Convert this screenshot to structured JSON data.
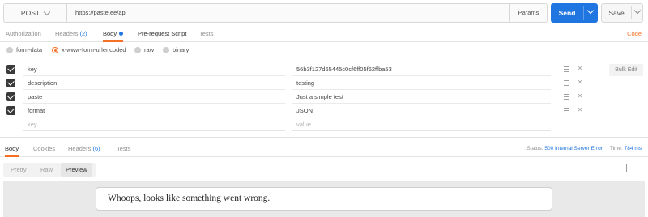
{
  "request": {
    "method": "POST",
    "url": "https://paste.ee/api",
    "params_label": "Params",
    "send_label": "Send",
    "save_label": "Save"
  },
  "request_tabs": {
    "authorization": "Authorization",
    "headers_label": "Headers",
    "headers_count": "(2)",
    "body": "Body",
    "prerequest": "Pre-request Script",
    "tests": "Tests",
    "code": "Code"
  },
  "body_types": {
    "form_data": "form-data",
    "urlencoded": "x-www-form-urlencoded",
    "raw": "raw",
    "binary": "binary",
    "selected": "x-www-form-urlencoded"
  },
  "params": [
    {
      "checked": true,
      "key": "key",
      "value": "56b3f127d65445c0cf6ff05f62ffba53"
    },
    {
      "checked": true,
      "key": "description",
      "value": "testing"
    },
    {
      "checked": true,
      "key": "paste",
      "value": "Just a simple test"
    },
    {
      "checked": true,
      "key": "format",
      "value": "JSON"
    }
  ],
  "new_row": {
    "key_placeholder": "key",
    "value_placeholder": "value"
  },
  "bulk_edit_label": "Bulk Edit",
  "response_tabs": {
    "body": "Body",
    "cookies": "Cookies",
    "headers_label": "Headers",
    "headers_count": "(6)",
    "tests": "Tests"
  },
  "response_status": {
    "status_label": "Status:",
    "status_value": "500 Internal Server Error",
    "time_label": "Time:",
    "time_value": "784 ms"
  },
  "view_modes": {
    "pretty": "Pretty",
    "raw": "Raw",
    "preview": "Preview",
    "selected": "Preview"
  },
  "preview_message": "Whoops, looks like something went wrong.",
  "colors": {
    "accent": "#f47023",
    "send": "#1f76e0",
    "link": "#1f76e0"
  }
}
